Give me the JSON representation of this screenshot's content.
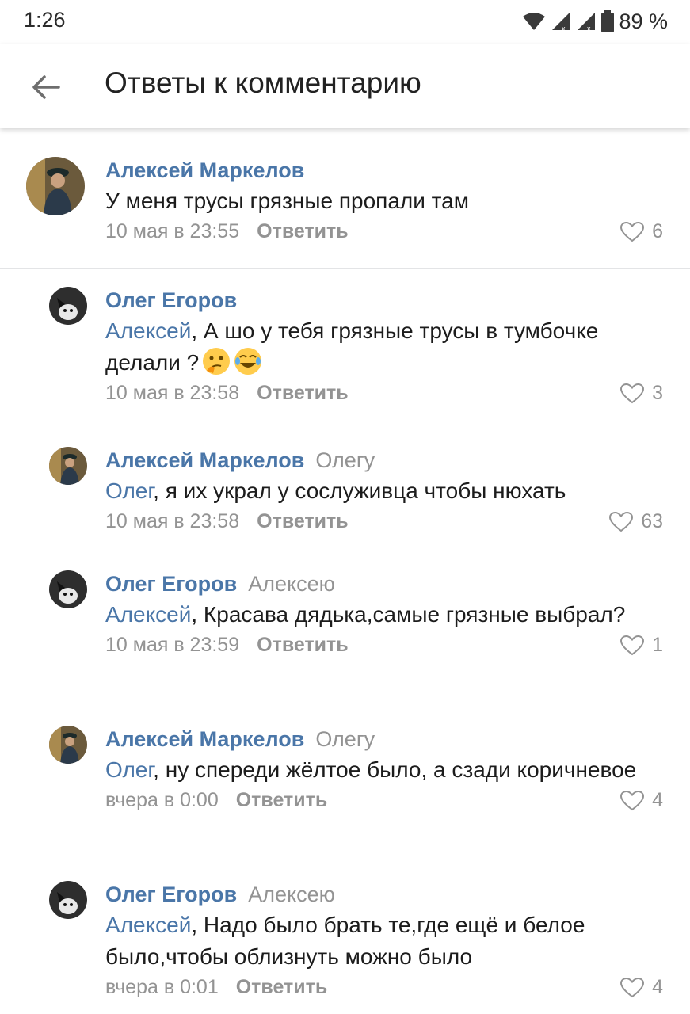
{
  "status_bar": {
    "time": "1:26",
    "battery": "89 %"
  },
  "header": {
    "title": "Ответы к комментарию"
  },
  "reply_label": "Ответить",
  "root": {
    "author": "Алексей Маркелов",
    "text": "У меня трусы грязные пропали там",
    "time": "10 мая в 23:55",
    "likes": "6"
  },
  "replies": [
    {
      "author": "Олег Егоров",
      "reply_to": "",
      "mention": "Алексей",
      "text": ", А шо у тебя грязные трусы в тумбочке делали ?",
      "time": "10 мая в 23:58",
      "likes": "3"
    },
    {
      "author": "Алексей Маркелов",
      "reply_to": "Олегу",
      "mention": "Олег",
      "text": ", я их украл у сослуживца чтобы нюхать",
      "time": "10 мая в 23:58",
      "likes": "63"
    },
    {
      "author": "Олег Егоров",
      "reply_to": "Алексею",
      "mention": "Алексей",
      "text": ", Красава дядька,самые грязные выбрал?",
      "time": "10 мая в 23:59",
      "likes": "1"
    },
    {
      "author": "Алексей Маркелов",
      "reply_to": "Олегу",
      "mention": "Олег",
      "text": ", ну спереди жёлтое было, а сзади коричневое",
      "time": "вчера в 0:00",
      "likes": "4"
    },
    {
      "author": "Олег Егоров",
      "reply_to": "Алексею",
      "mention": "Алексей",
      "text": ", Надо было брать те,где ещё и белое было,чтобы облизнуть можно было",
      "time": "вчера в 0:01",
      "likes": "4"
    }
  ],
  "colors": {
    "link": "#4a76a8",
    "muted": "#939393",
    "text": "#1c1c1c"
  },
  "icons": {
    "back": "arrow-left-icon",
    "like": "heart-outline-icon"
  }
}
